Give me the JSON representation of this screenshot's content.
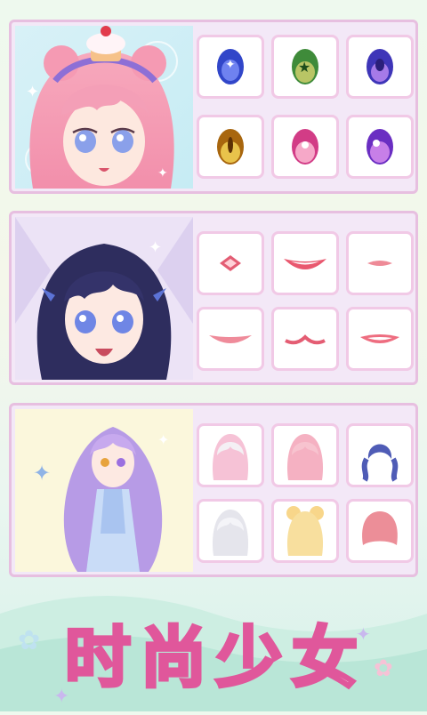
{
  "title": {
    "chars": [
      "时",
      "尚",
      "少",
      "女"
    ]
  },
  "panels": [
    {
      "category": "eyes",
      "items": [
        "blue-eye",
        "green-eye",
        "purple-eye",
        "amber-eye",
        "pink-eye",
        "violet-eye"
      ]
    },
    {
      "category": "mouths",
      "items": [
        "small-mouth",
        "smile-mouth",
        "closed-mouth",
        "wide-mouth",
        "cat-mouth",
        "open-mouth"
      ]
    },
    {
      "category": "hair",
      "items": [
        "white-pink-hair",
        "pink-long-hair",
        "navy-twin-hair",
        "silver-hair",
        "blonde-bun-hair",
        "pink-bob-hair"
      ]
    }
  ],
  "colors": {
    "panel_border": "#e7bfe0",
    "tile_border": "#f1c9e6",
    "title_fill": "#ffffff",
    "title_outline": "#e0579b"
  }
}
